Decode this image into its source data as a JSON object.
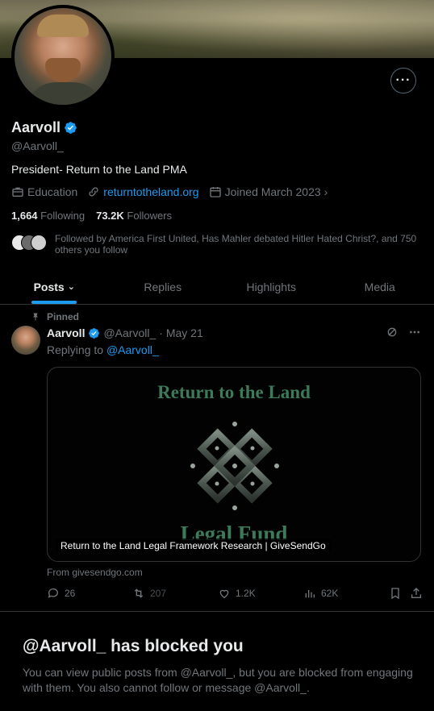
{
  "profile": {
    "name": "Aarvoll",
    "handle": "@Aarvoll_",
    "bio": "President- Return to the Land PMA",
    "category": "Education",
    "website": "returntotheland.org",
    "joined": "Joined March 2023",
    "following_count": "1,664",
    "following_label": "Following",
    "followers_count": "73.2K",
    "followers_label": "Followers",
    "followed_by": "Followed by America First United, Has Mahler debated Hitler Hated Christ?, and 750 others you follow",
    "more_label": "···"
  },
  "tabs": [
    {
      "label": "Posts"
    },
    {
      "label": "Replies"
    },
    {
      "label": "Highlights"
    },
    {
      "label": "Media"
    }
  ],
  "post": {
    "pinned_label": "Pinned",
    "author_name": "Aarvoll",
    "author_handle": "@Aarvoll_",
    "date": "· May 21",
    "replying_prefix": "Replying to",
    "replying_to": "@Aarvoll_",
    "card": {
      "image_title": "Return to the Land",
      "image_subtitle": "Legal Fund",
      "caption": "Return to the Land Legal Framework Research | GiveSendGo"
    },
    "from": "From givesendgo.com",
    "stats": {
      "replies": "26",
      "reposts": "207",
      "likes": "1.2K",
      "views": "62K"
    }
  },
  "blocked": {
    "title": "@Aarvoll_ has blocked you",
    "text": "You can view public posts from @Aarvoll_, but you are blocked from engaging with them. You also cannot follow or message @Aarvoll_."
  },
  "colors": {
    "accent": "#1d9bf0",
    "muted": "#71767b",
    "card_text": "#3d7a5a"
  }
}
